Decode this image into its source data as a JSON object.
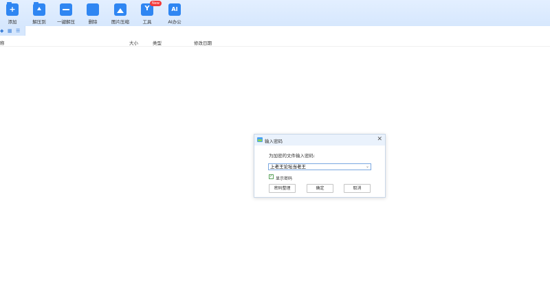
{
  "toolbar": {
    "items": [
      {
        "label": "添加",
        "icon": "add-folder-icon"
      },
      {
        "label": "解压到",
        "icon": "extract-to-icon"
      },
      {
        "label": "一键解压",
        "icon": "one-click-extract-icon"
      },
      {
        "label": "删除",
        "icon": "delete-icon"
      },
      {
        "label": "图片压缩",
        "icon": "image-compress-icon"
      },
      {
        "label": "工具",
        "icon": "tools-icon",
        "badge": "New"
      },
      {
        "label": "AI办公",
        "icon": "ai-office-icon"
      }
    ]
  },
  "columns": {
    "name": "称",
    "size": "大小",
    "type": "类型",
    "modified": "修改日期"
  },
  "dialog": {
    "title": "输入密码",
    "prompt": "为加密的文件输入密码:",
    "password_value": "上老王论坛当老王",
    "show_password_label": "显示密码",
    "show_password_checked": true,
    "buttons": {
      "manage": "密码整理",
      "ok": "确定",
      "cancel": "取消"
    }
  },
  "colors": {
    "accent": "#2f86f2",
    "toolbar_bg": "#d6e7fd",
    "badge": "#f23a3a"
  }
}
